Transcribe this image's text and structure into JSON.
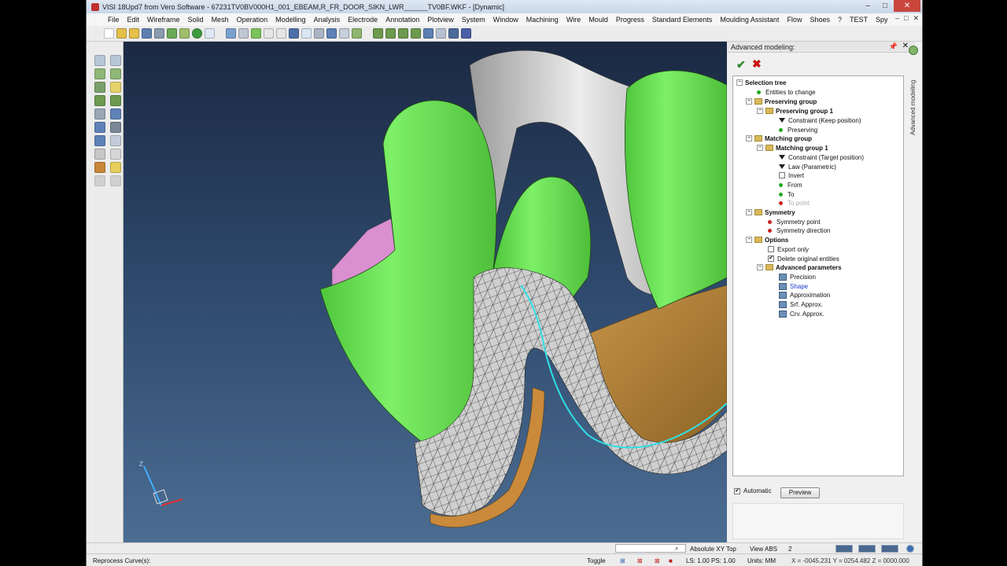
{
  "window": {
    "title": "VISI 18Upd7 from Vero Software - 67231TV0BV000H1_001_EBEAM,R_FR_DOOR_SIKN_LWR______TV0BF.WKF - [Dynamic]",
    "min_glyph": "–",
    "max_glyph": "□",
    "close_glyph": "✕"
  },
  "menubar": {
    "items": [
      "File",
      "Edit",
      "Wireframe",
      "Solid",
      "Mesh",
      "Operation",
      "Modelling",
      "Analysis",
      "Electrode",
      "Annotation",
      "Plotview",
      "System",
      "Window",
      "Machining",
      "Wire",
      "Mould",
      "Progress",
      "Standard Elements",
      "Moulding Assistant",
      "Flow",
      "Shoes",
      "?",
      "TEST",
      "Spy"
    ]
  },
  "panel": {
    "title": "Advanced modeling:",
    "vertical_tab": "Advanced modeling",
    "ok_glyph": "✔",
    "cancel_glyph": "✖",
    "tree": [
      {
        "label": "Selection tree",
        "depth": 0,
        "kind": "root",
        "bold": true
      },
      {
        "label": "Entities to change",
        "depth": 1,
        "kind": "dot-green"
      },
      {
        "label": "Preserving group",
        "depth": 1,
        "kind": "folder",
        "bold": true
      },
      {
        "label": "Preserving group 1",
        "depth": 2,
        "kind": "folder",
        "bold": true
      },
      {
        "label": "Constraint (Keep position)",
        "depth": 3,
        "kind": "funnel"
      },
      {
        "label": "Preserving",
        "depth": 3,
        "kind": "dot-green"
      },
      {
        "label": "Matching group",
        "depth": 1,
        "kind": "folder",
        "bold": true
      },
      {
        "label": "Matching group 1",
        "depth": 2,
        "kind": "folder",
        "bold": true
      },
      {
        "label": "Constraint (Target position)",
        "depth": 3,
        "kind": "funnel"
      },
      {
        "label": "Law (Parametric)",
        "depth": 3,
        "kind": "funnel"
      },
      {
        "label": "Invert",
        "depth": 3,
        "kind": "check"
      },
      {
        "label": "From",
        "depth": 3,
        "kind": "dot-green"
      },
      {
        "label": "To",
        "depth": 3,
        "kind": "dot-green"
      },
      {
        "label": "To point",
        "depth": 3,
        "kind": "dot-red",
        "grey": true
      },
      {
        "label": "Symmetry",
        "depth": 1,
        "kind": "folder",
        "bold": true
      },
      {
        "label": "Symmetry point",
        "depth": 2,
        "kind": "dot-red"
      },
      {
        "label": "Symmetry direction",
        "depth": 2,
        "kind": "dot-red"
      },
      {
        "label": "Options",
        "depth": 1,
        "kind": "folder",
        "bold": true
      },
      {
        "label": "Export only",
        "depth": 2,
        "kind": "check"
      },
      {
        "label": "Delete original entities",
        "depth": 2,
        "kind": "check-on"
      },
      {
        "label": "Advanced parameters",
        "depth": 2,
        "kind": "folder",
        "bold": true
      },
      {
        "label": "Precision",
        "depth": 3,
        "kind": "param"
      },
      {
        "label": "Shape",
        "depth": 3,
        "kind": "param",
        "blue": true
      },
      {
        "label": "Approximation",
        "depth": 3,
        "kind": "param"
      },
      {
        "label": "Srf. Approx.",
        "depth": 3,
        "kind": "param"
      },
      {
        "label": "Crv. Approx.",
        "depth": 3,
        "kind": "param"
      }
    ],
    "automatic_label": "Automatic",
    "preview_label": "Preview"
  },
  "axis": {
    "z": "Z"
  },
  "status": {
    "prompt": "Reprocess Curve(s):",
    "absolute": "Absolute XY Top",
    "view": "View ABS",
    "count": "2",
    "toggle": "Toggle",
    "ls_ps": "LS: 1.00 PS: 1.00",
    "units": "Units: MM",
    "coords": "X = -0045.231 Y = 0254.482 Z = 0000.000"
  },
  "colors": {
    "accent_green": "#6fe05a",
    "mesh_grey": "#cfcfcf",
    "bronze": "#b8853a",
    "pink": "#d98fd0",
    "edge_cyan": "#2fe0e6"
  }
}
